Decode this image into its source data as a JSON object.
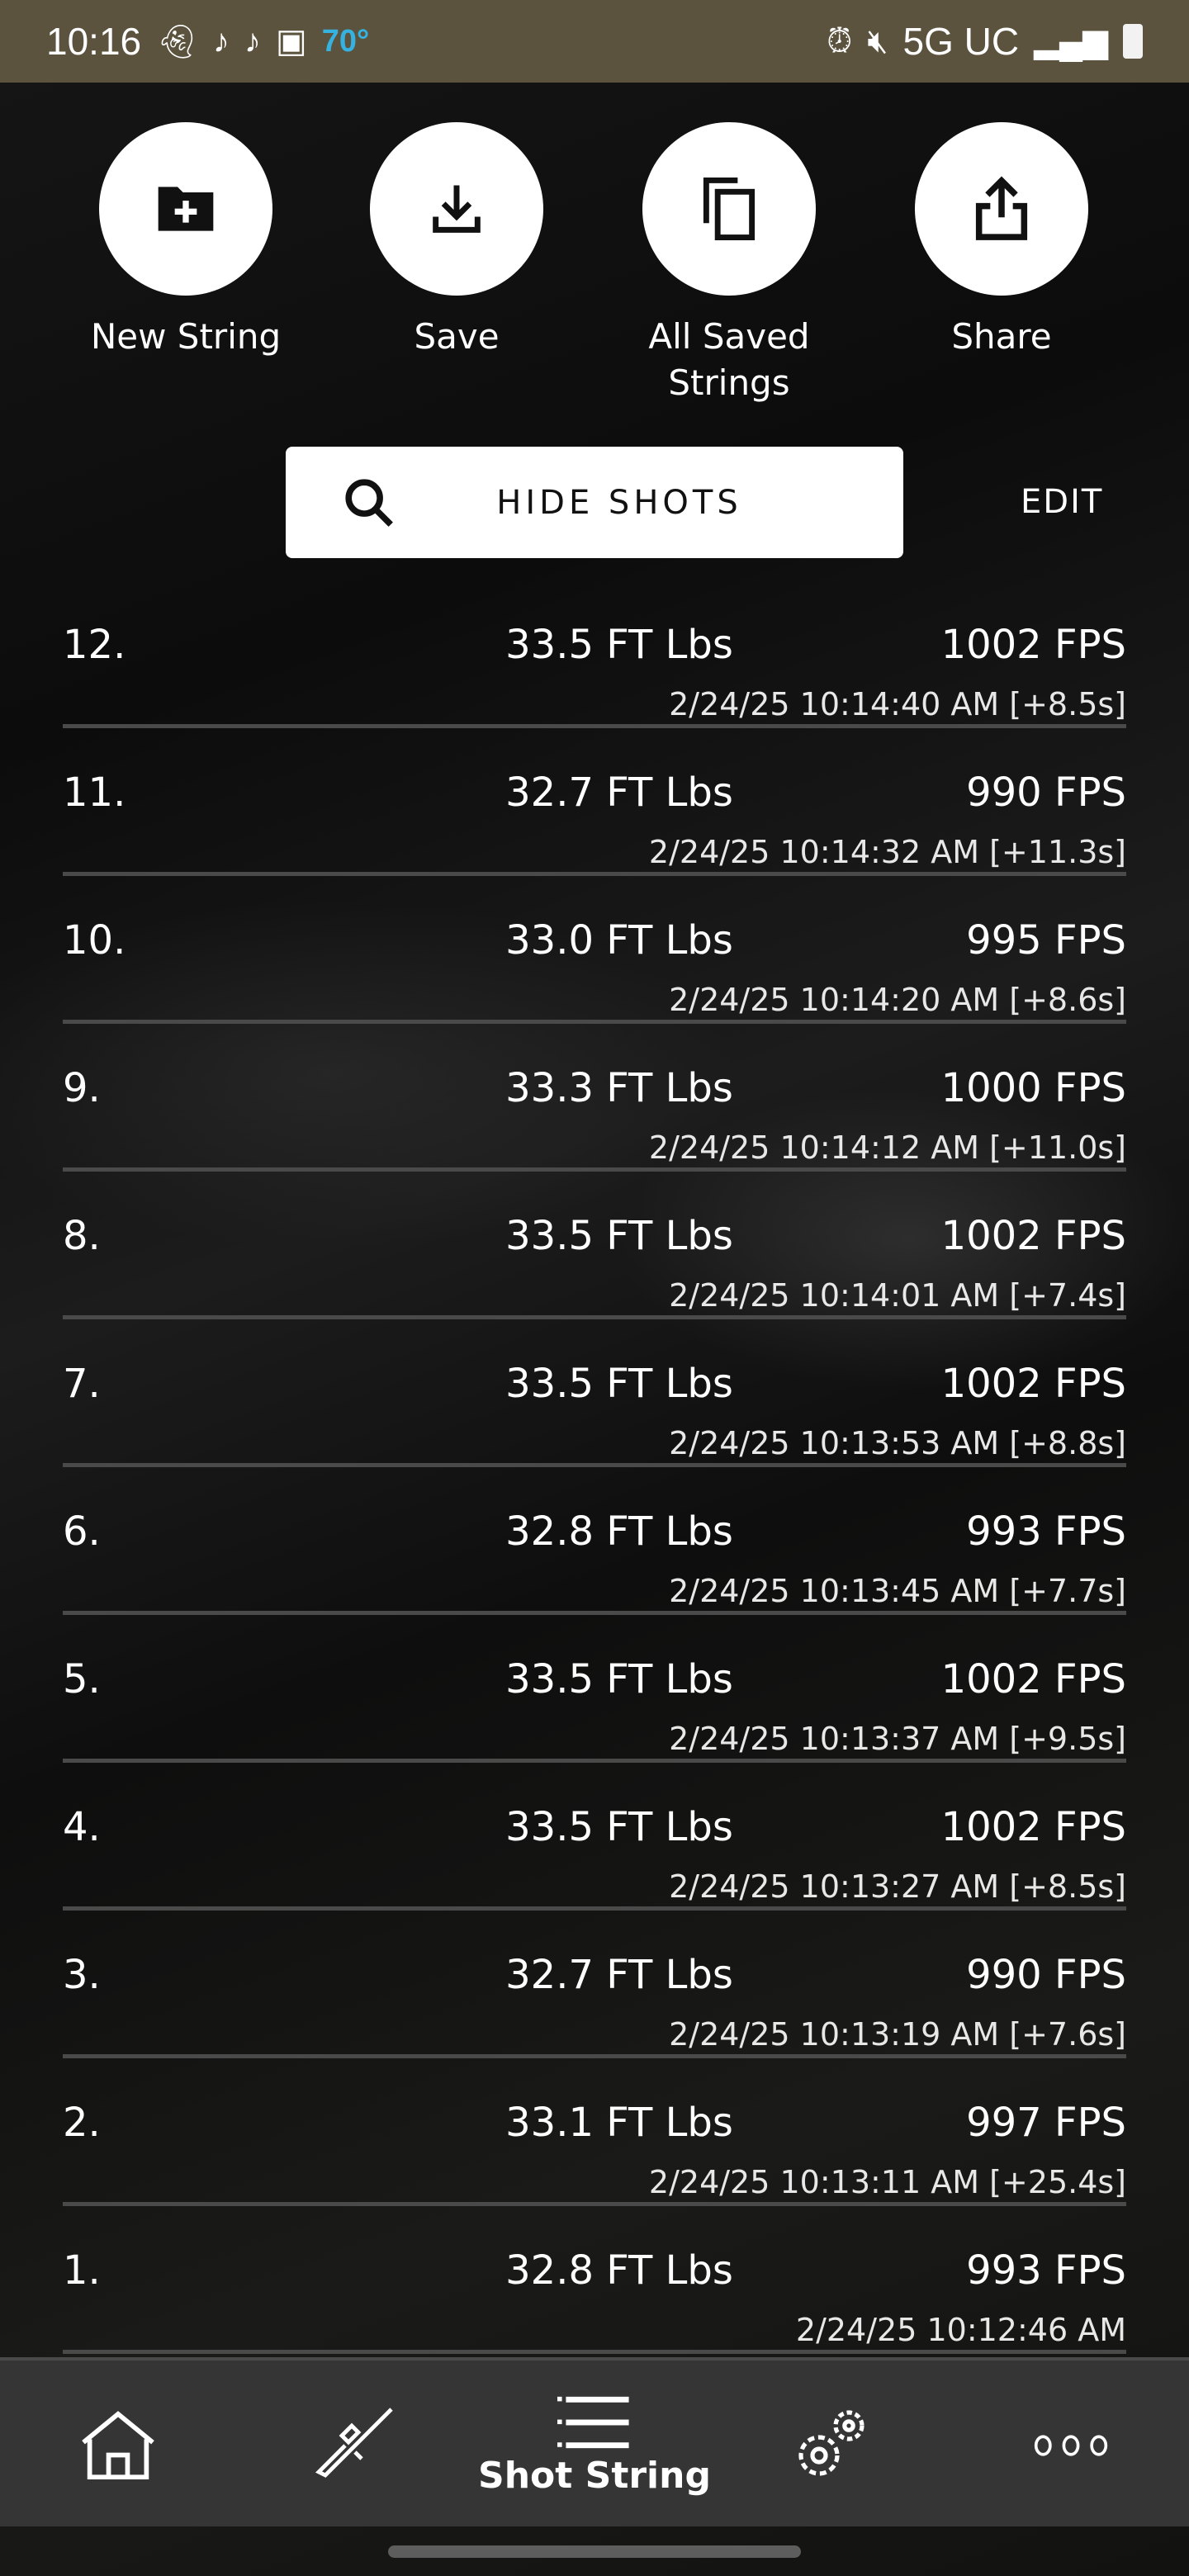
{
  "status_bar": {
    "time": "10:16",
    "temperature": "70°",
    "network": "5G UC",
    "icons": [
      "snapchat-icon",
      "tiktok-icon",
      "tiktok-icon",
      "gallery-icon",
      "alarm-icon",
      "mute-icon",
      "signal-icon",
      "battery-icon"
    ]
  },
  "actions": [
    {
      "label": "New String",
      "icon": "new-folder-icon"
    },
    {
      "label": "Save",
      "icon": "download-icon"
    },
    {
      "label": "All Saved Strings",
      "icon": "copy-icon"
    },
    {
      "label": "Share",
      "icon": "share-icon"
    }
  ],
  "search": {
    "label": "HIDE SHOTS",
    "icon": "search-icon"
  },
  "edit_label": "EDIT",
  "shots": [
    {
      "num": "12.",
      "energy": "33.5 FT Lbs",
      "fps": "1002 FPS",
      "time": "2/24/25 10:14:40 AM [+8.5s]"
    },
    {
      "num": "11.",
      "energy": "32.7 FT Lbs",
      "fps": "990 FPS",
      "time": "2/24/25 10:14:32 AM [+11.3s]"
    },
    {
      "num": "10.",
      "energy": "33.0 FT Lbs",
      "fps": "995 FPS",
      "time": "2/24/25 10:14:20 AM [+8.6s]"
    },
    {
      "num": "9.",
      "energy": "33.3 FT Lbs",
      "fps": "1000 FPS",
      "time": "2/24/25 10:14:12 AM [+11.0s]"
    },
    {
      "num": "8.",
      "energy": "33.5 FT Lbs",
      "fps": "1002 FPS",
      "time": "2/24/25 10:14:01 AM [+7.4s]"
    },
    {
      "num": "7.",
      "energy": "33.5 FT Lbs",
      "fps": "1002 FPS",
      "time": "2/24/25 10:13:53 AM [+8.8s]"
    },
    {
      "num": "6.",
      "energy": "32.8 FT Lbs",
      "fps": "993 FPS",
      "time": "2/24/25 10:13:45 AM [+7.7s]"
    },
    {
      "num": "5.",
      "energy": "33.5 FT Lbs",
      "fps": "1002 FPS",
      "time": "2/24/25 10:13:37 AM [+9.5s]"
    },
    {
      "num": "4.",
      "energy": "33.5 FT Lbs",
      "fps": "1002 FPS",
      "time": "2/24/25 10:13:27 AM [+8.5s]"
    },
    {
      "num": "3.",
      "energy": "32.7 FT Lbs",
      "fps": "990 FPS",
      "time": "2/24/25 10:13:19 AM [+7.6s]"
    },
    {
      "num": "2.",
      "energy": "33.1 FT Lbs",
      "fps": "997 FPS",
      "time": "2/24/25 10:13:11 AM [+25.4s]"
    },
    {
      "num": "1.",
      "energy": "32.8 FT Lbs",
      "fps": "993 FPS",
      "time": "2/24/25 10:12:46 AM"
    }
  ],
  "bottom_nav": {
    "active": "Shot String",
    "items": [
      {
        "icon": "home-icon",
        "label": ""
      },
      {
        "icon": "rifle-icon",
        "label": ""
      },
      {
        "icon": "list-icon",
        "label": "Shot String"
      },
      {
        "icon": "gears-icon",
        "label": ""
      },
      {
        "icon": "more-icon",
        "label": ""
      }
    ]
  }
}
